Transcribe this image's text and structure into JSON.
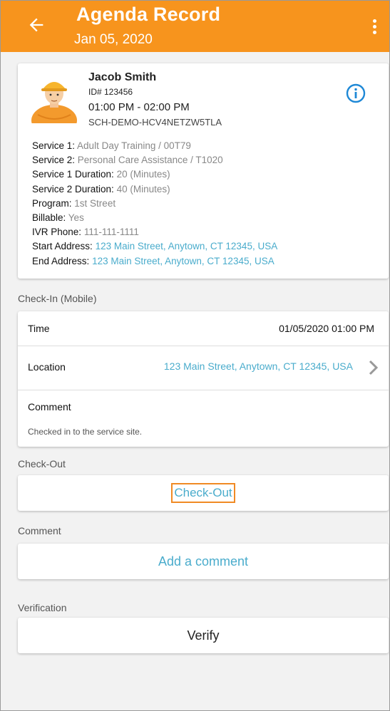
{
  "header": {
    "title": "Agenda Record",
    "date": "Jan 05, 2020",
    "color": "#f7941d"
  },
  "client": {
    "name": "Jacob Smith",
    "id": "ID# 123456",
    "time_range": "01:00 PM - 02:00 PM",
    "code": "SCH-DEMO-HCV4NETZW5TLA",
    "details": [
      {
        "label": "Service 1:",
        "value": "Adult Day Training / 00T79",
        "type": "text"
      },
      {
        "label": "Service 2:",
        "value": "Personal Care Assistance / T1020",
        "type": "text"
      },
      {
        "label": "Service 1 Duration:",
        "value": "20 (Minutes)",
        "type": "text"
      },
      {
        "label": "Service 2 Duration:",
        "value": "40 (Minutes)",
        "type": "text"
      },
      {
        "label": "Program:",
        "value": "1st Street",
        "type": "text"
      },
      {
        "label": "Billable:",
        "value": "Yes",
        "type": "text"
      },
      {
        "label": "IVR Phone:",
        "value": "111-111-1111",
        "type": "text"
      },
      {
        "label": "Start Address:",
        "value": "123 Main Street, Anytown, CT 12345, USA",
        "type": "link"
      },
      {
        "label": "End Address:",
        "value": "123 Main Street, Anytown, CT 12345, USA",
        "type": "link"
      }
    ]
  },
  "checkin": {
    "section_label": "Check-In (Mobile)",
    "time_label": "Time",
    "time_value": "01/05/2020 01:00 PM",
    "location_label": "Location",
    "location_value": "123 Main Street, Anytown, CT 12345, USA",
    "comment_label": "Comment",
    "comment_value": "Checked in to the service site."
  },
  "checkout": {
    "section_label": "Check-Out",
    "button_label": "Check-Out"
  },
  "comment": {
    "section_label": "Comment",
    "button_label": "Add a comment"
  },
  "verification": {
    "section_label": "Verification",
    "button_label": "Verify"
  },
  "colors": {
    "accent": "#f7941d",
    "link": "#4aaccc",
    "highlight_border": "#f08a24"
  }
}
